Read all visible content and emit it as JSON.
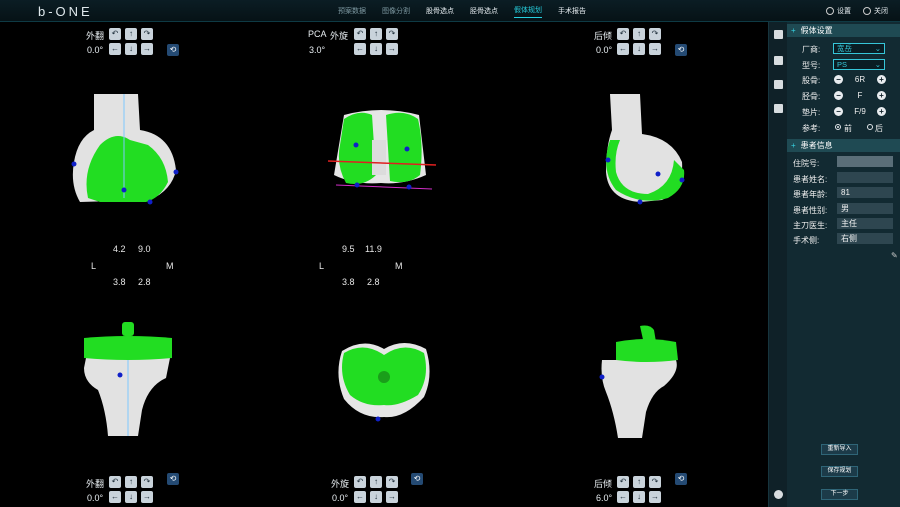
{
  "app": {
    "logo": "b-ONE",
    "nav": [
      "预案数据",
      "图像分割",
      "股骨选点",
      "胫骨选点",
      "假体规划",
      "手术报告"
    ],
    "top_actions": {
      "settings": "设置",
      "close": "关闭"
    }
  },
  "views": {
    "tl": {
      "label": "外翻",
      "angle": "0.0°"
    },
    "tc": {
      "label1": "PCA",
      "label2": "外旋",
      "angle": "3.0°"
    },
    "tr": {
      "label": "后倾",
      "angle": "0.0°"
    },
    "bl": {
      "label": "外翻",
      "angle": "0.0°"
    },
    "bc": {
      "label": "外旋",
      "angle": "0.0°"
    },
    "br": {
      "label": "后倾",
      "angle": "6.0°"
    }
  },
  "measurements": {
    "left": {
      "top_l": "4.2",
      "top_r": "9.0",
      "L": "L",
      "M": "M",
      "bot_l": "3.8",
      "bot_r": "2.8"
    },
    "center": {
      "top_l": "9.5",
      "top_r": "11.9",
      "L": "L",
      "M": "M",
      "bot_l": "3.8",
      "bot_r": "2.8"
    }
  },
  "sidebar": {
    "implant_title": "假体设置",
    "manufacturer_label": "厂商:",
    "manufacturer_value": "宽岳",
    "model_label": "型号:",
    "model_value": "PS",
    "femur_label": "股骨:",
    "femur_value": "6R",
    "tibia_label": "胫骨:",
    "tibia_value": "F",
    "insert_label": "垫片:",
    "insert_value": "F/9",
    "ref_label": "参考:",
    "ref_front": "前",
    "ref_back": "后",
    "patient_title": "患者信息",
    "patient_rows": [
      {
        "label": "住院号:",
        "value": ""
      },
      {
        "label": "患者姓名:",
        "value": ""
      },
      {
        "label": "患者年龄:",
        "value": "81"
      },
      {
        "label": "患者性别:",
        "value": "男"
      },
      {
        "label": "主刀医生:",
        "value": "主任"
      },
      {
        "label": "手术侧:",
        "value": "右侧"
      }
    ],
    "buttons": {
      "reimport": "重新导入",
      "save": "保存规划",
      "next": "下一步"
    }
  },
  "colors": {
    "implant": "#22dd22",
    "bone": "#e4e4e4",
    "accent": "#36d1e0",
    "marker": "#1020c8"
  }
}
